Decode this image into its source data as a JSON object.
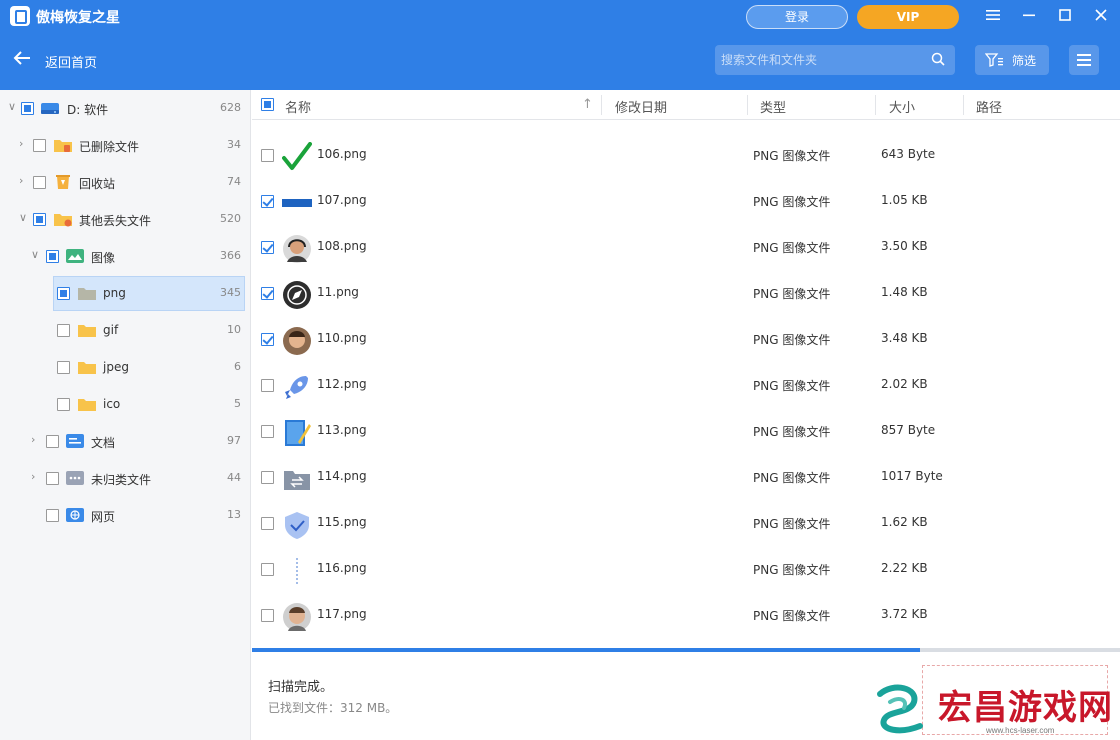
{
  "app": {
    "title": "傲梅恢复之星"
  },
  "header": {
    "login_label": "登录",
    "vip_label": "VIP",
    "back_label": "返回首页",
    "search_placeholder": "搜索文件和文件夹",
    "filter_label": "筛选"
  },
  "colors": {
    "accent": "#2f7fe6",
    "vip": "#f5a623",
    "sidebar_bg": "#f5f6f8",
    "selected_bg": "#d4e6fb"
  },
  "sidebar": {
    "items": [
      {
        "label": "D: 软件",
        "count": "628",
        "icon": "drive-icon",
        "level": 0,
        "expanded": true,
        "check": "partial"
      },
      {
        "label": "已删除文件",
        "count": "34",
        "icon": "deleted-folder-icon",
        "level": 1,
        "expanded": false,
        "check": "none"
      },
      {
        "label": "回收站",
        "count": "74",
        "icon": "recycle-bin-icon",
        "level": 1,
        "expanded": false,
        "check": "none"
      },
      {
        "label": "其他丢失文件",
        "count": "520",
        "icon": "lost-files-folder-icon",
        "level": 1,
        "expanded": true,
        "check": "partial"
      },
      {
        "label": "图像",
        "count": "366",
        "icon": "image-category-icon",
        "level": 2,
        "expanded": true,
        "check": "partial"
      },
      {
        "label": "png",
        "count": "345",
        "icon": "folder-icon",
        "level": 3,
        "selected": true,
        "check": "partial"
      },
      {
        "label": "gif",
        "count": "10",
        "icon": "folder-icon",
        "level": 3,
        "check": "none"
      },
      {
        "label": "jpeg",
        "count": "6",
        "icon": "folder-icon",
        "level": 3,
        "check": "none"
      },
      {
        "label": "ico",
        "count": "5",
        "icon": "folder-icon",
        "level": 3,
        "check": "none"
      },
      {
        "label": "文档",
        "count": "97",
        "icon": "document-category-icon",
        "level": 2,
        "expanded": false,
        "check": "none"
      },
      {
        "label": "未归类文件",
        "count": "44",
        "icon": "unclassified-category-icon",
        "level": 2,
        "expanded": false,
        "check": "none"
      },
      {
        "label": "网页",
        "count": "13",
        "icon": "web-category-icon",
        "level": 2,
        "check": "none"
      }
    ]
  },
  "table": {
    "columns": {
      "name": "名称",
      "date": "修改日期",
      "type": "类型",
      "size": "大小",
      "path": "路径"
    },
    "rows": [
      {
        "name": "106.png",
        "type": "PNG 图像文件",
        "size": "643 Byte",
        "checked": false,
        "thumb": "green-checkmark-icon"
      },
      {
        "name": "107.png",
        "type": "PNG 图像文件",
        "size": "1.05 KB",
        "checked": true,
        "thumb": "blue-bar-image"
      },
      {
        "name": "108.png",
        "type": "PNG 图像文件",
        "size": "3.50 KB",
        "checked": true,
        "thumb": "avatar-headset-image"
      },
      {
        "name": "11.png",
        "type": "PNG 图像文件",
        "size": "1.48 KB",
        "checked": true,
        "thumb": "compass-icon"
      },
      {
        "name": "110.png",
        "type": "PNG 图像文件",
        "size": "3.48 KB",
        "checked": true,
        "thumb": "avatar-man-image"
      },
      {
        "name": "112.png",
        "type": "PNG 图像文件",
        "size": "2.02 KB",
        "checked": false,
        "thumb": "rocket-icon"
      },
      {
        "name": "113.png",
        "type": "PNG 图像文件",
        "size": "857 Byte",
        "checked": false,
        "thumb": "notebook-pencil-icon"
      },
      {
        "name": "114.png",
        "type": "PNG 图像文件",
        "size": "1017 Byte",
        "checked": false,
        "thumb": "folder-sync-icon"
      },
      {
        "name": "115.png",
        "type": "PNG 图像文件",
        "size": "1.62 KB",
        "checked": false,
        "thumb": "shield-check-icon"
      },
      {
        "name": "116.png",
        "type": "PNG 图像文件",
        "size": "2.22 KB",
        "checked": false,
        "thumb": "dotted-line-image"
      },
      {
        "name": "117.png",
        "type": "PNG 图像文件",
        "size": "3.72 KB",
        "checked": false,
        "thumb": "avatar-man-2-image"
      }
    ]
  },
  "status": {
    "main": "扫描完成。",
    "sub": "已找到文件：312 MB。",
    "progress": 0.77
  },
  "watermark": {
    "text": "宏昌游戏网",
    "url": "www.hcs-laser.com"
  }
}
